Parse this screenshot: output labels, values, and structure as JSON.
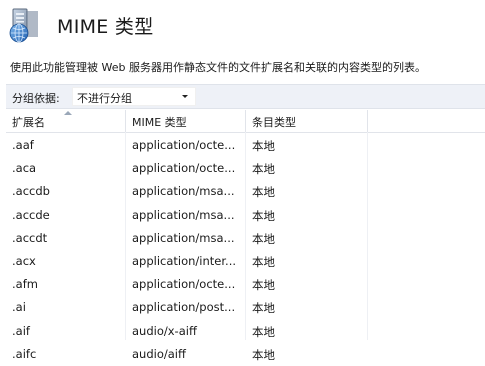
{
  "header": {
    "title": "MIME 类型",
    "description": "使用此功能管理被 Web 服务器用作静态文件的文件扩展名和关联的内容类型的列表。"
  },
  "group_by": {
    "label": "分组依据:",
    "value": "不进行分组"
  },
  "table": {
    "columns": [
      "扩展名",
      "MIME 类型",
      "条目类型"
    ],
    "sorted_column": "扩展名",
    "sort_direction": "ascending",
    "rows": [
      {
        "ext": ".aaf",
        "mime": "application/octe...",
        "type": "本地"
      },
      {
        "ext": ".aca",
        "mime": "application/octe...",
        "type": "本地"
      },
      {
        "ext": ".accdb",
        "mime": "application/msa...",
        "type": "本地"
      },
      {
        "ext": ".accde",
        "mime": "application/msa...",
        "type": "本地"
      },
      {
        "ext": ".accdt",
        "mime": "application/msa...",
        "type": "本地"
      },
      {
        "ext": ".acx",
        "mime": "application/inter...",
        "type": "本地"
      },
      {
        "ext": ".afm",
        "mime": "application/octe...",
        "type": "本地"
      },
      {
        "ext": ".ai",
        "mime": "application/post...",
        "type": "本地"
      },
      {
        "ext": ".aif",
        "mime": "audio/x-aiff",
        "type": "本地"
      },
      {
        "ext": ".aifc",
        "mime": "audio/aiff",
        "type": "本地"
      }
    ]
  },
  "icon": "server-icon"
}
